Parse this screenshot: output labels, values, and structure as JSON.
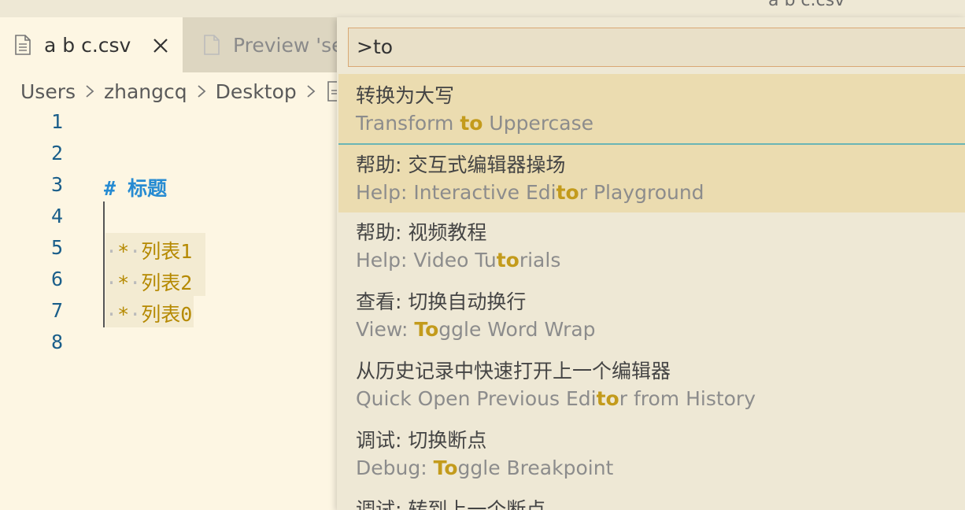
{
  "window": {
    "title": "a b c.csv"
  },
  "tabs": [
    {
      "label": "a b c.csv",
      "active": true
    },
    {
      "label": "Preview 'se",
      "active": false
    }
  ],
  "breadcrumb": [
    "Users",
    "zhangcq",
    "Desktop"
  ],
  "editor": {
    "line_numbers": [
      "1",
      "2",
      "3",
      "4",
      "5",
      "6",
      "7",
      "8"
    ],
    "heading_hash": "#",
    "heading_text": "标题",
    "list_items": [
      {
        "dot": "·",
        "bullet": "*",
        "text": "列表1"
      },
      {
        "dot": "·",
        "bullet": "*",
        "text": "列表2"
      },
      {
        "dot": "·",
        "bullet": "*",
        "text": "列表0"
      }
    ]
  },
  "palette": {
    "query": ">to",
    "items": [
      {
        "zh": "转换为大写",
        "en_before": "Transform ",
        "en_match": "to",
        "en_after": " Uppercase"
      },
      {
        "zh": "帮助: 交互式编辑器操场",
        "en_before": "Help: Interactive Edi",
        "en_match": "to",
        "en_after": "r Playground"
      },
      {
        "zh": "帮助: 视频教程",
        "en_before": "Help: Video Tu",
        "en_match": "to",
        "en_after": "rials"
      },
      {
        "zh": "查看: 切换自动换行",
        "en_before": "View: ",
        "en_match": "To",
        "en_after": "ggle Word Wrap"
      },
      {
        "zh": "从历史记录中快速打开上一个编辑器",
        "en_before": "Quick Open Previous Edi",
        "en_match": "to",
        "en_after": "r from History"
      },
      {
        "zh": "调试: 切换断点",
        "en_before": "Debug: ",
        "en_match": "To",
        "en_after": "ggle Breakpoint"
      },
      {
        "zh": "调试: 转到上一个断点"
      }
    ]
  },
  "colors": {
    "editor_bg": "#fdf6e3",
    "highlight": "#c39b1c",
    "heading": "#268bd2",
    "line_number": "#1a5e8a",
    "input_border": "#d9a874"
  },
  "icons": {
    "tab_file": "file-icon",
    "tab_close": "close-icon",
    "breadcrumb_sep": "chevron-right-icon"
  }
}
